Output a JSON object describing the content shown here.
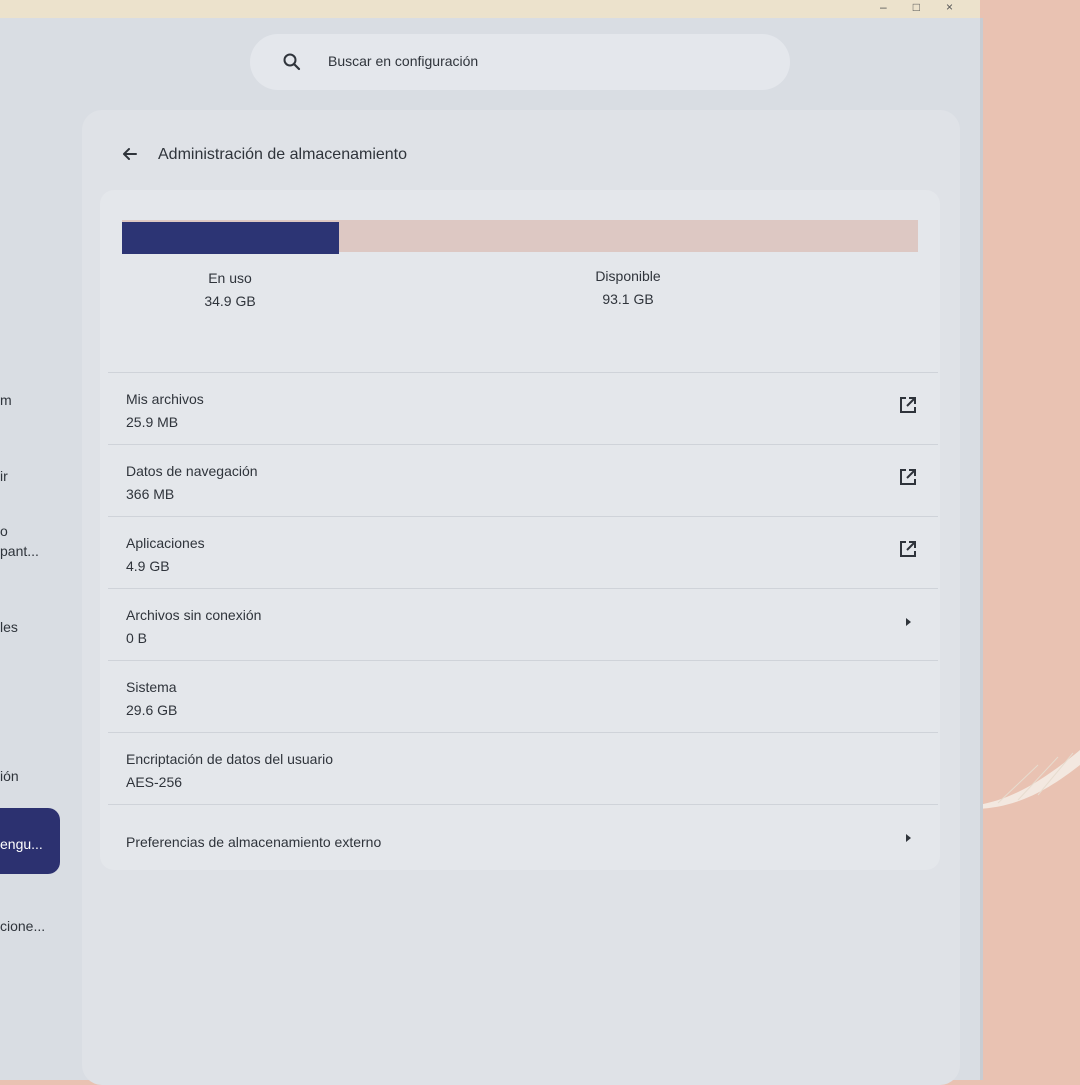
{
  "search": {
    "placeholder": "Buscar en configuración"
  },
  "page": {
    "title": "Administración de almacenamiento"
  },
  "storage": {
    "used_fraction": 0.273,
    "in_use": {
      "label": "En uso",
      "value": "34.9 GB"
    },
    "available": {
      "label": "Disponible",
      "value": "93.1 GB"
    },
    "colors": {
      "used": "#2c3474",
      "free": "#ddc8c3"
    }
  },
  "items": [
    {
      "title": "Mis archivos",
      "subtitle": "25.9 MB",
      "icon": "external-link-icon"
    },
    {
      "title": "Datos de navegación",
      "subtitle": "366 MB",
      "icon": "external-link-icon"
    },
    {
      "title": "Aplicaciones",
      "subtitle": "4.9 GB",
      "icon": "external-link-icon"
    },
    {
      "title": "Archivos sin conexión",
      "subtitle": "0 B",
      "icon": "chevron-right-icon"
    },
    {
      "title": "Sistema",
      "subtitle": "29.6 GB",
      "icon": ""
    },
    {
      "title": "Encriptación de datos del usuario",
      "subtitle": "AES-256",
      "icon": ""
    },
    {
      "title": "Preferencias de almacenamiento externo",
      "subtitle": "",
      "icon": "chevron-right-icon"
    }
  ],
  "sidebar": {
    "fragments": [
      "m",
      "ir",
      "o",
      "pant...",
      "les",
      "ión",
      "cione..."
    ],
    "active": {
      "line1": "",
      "line2": "engu..."
    }
  }
}
